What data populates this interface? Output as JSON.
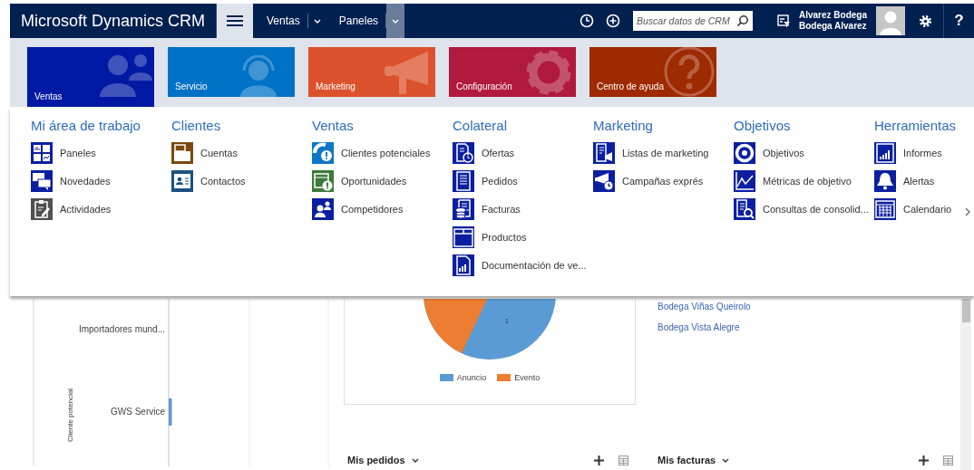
{
  "header": {
    "app_title": "Microsoft Dynamics CRM",
    "nav": [
      {
        "label": "Ventas",
        "active": false
      },
      {
        "label": "Paneles",
        "active": true
      }
    ],
    "search": {
      "placeholder": "Buscar datos de CRM"
    },
    "user": {
      "name": "Alvarez Bodega",
      "organization": "Bodega Alvarez"
    },
    "help": "?"
  },
  "tiles": [
    {
      "label": "Ventas",
      "kind": "people",
      "color": "#0019a5",
      "selected": true
    },
    {
      "label": "Servicio",
      "kind": "agent",
      "color": "#0072c6",
      "selected": false
    },
    {
      "label": "Marketing",
      "kind": "megaphone",
      "color": "#dc522c",
      "selected": false
    },
    {
      "label": "Configuración",
      "kind": "gear",
      "color": "#b1193e",
      "selected": false
    },
    {
      "label": "Centro de ayuda",
      "kind": "help",
      "color": "#9e2a00",
      "selected": false
    }
  ],
  "menu": {
    "groups": [
      {
        "title": "Mi área de trabajo",
        "items": [
          {
            "label": "Paneles",
            "kind": "dashboard",
            "color": "#0b1fa0"
          },
          {
            "label": "Novedades",
            "kind": "feed",
            "color": "#0b1fa0"
          },
          {
            "label": "Actividades",
            "kind": "activity",
            "color": "#505050"
          }
        ]
      },
      {
        "title": "Clientes",
        "items": [
          {
            "label": "Cuentas",
            "kind": "account",
            "color": "#7a4a10"
          },
          {
            "label": "Contactos",
            "kind": "contact",
            "color": "#1a5282"
          }
        ]
      },
      {
        "title": "Ventas",
        "items": [
          {
            "label": "Clientes potenciales",
            "kind": "lead",
            "color": "#0f76c8"
          },
          {
            "label": "Oportunidades",
            "kind": "opportunity",
            "color": "#3e7a3a"
          },
          {
            "label": "Competidores",
            "kind": "competitor",
            "color": "#0b1fa0"
          }
        ]
      },
      {
        "title": "Colateral",
        "items": [
          {
            "label": "Ofertas",
            "kind": "quote",
            "color": "#0b1fa0"
          },
          {
            "label": "Pedidos",
            "kind": "order",
            "color": "#0b1fa0"
          },
          {
            "label": "Facturas",
            "kind": "invoice",
            "color": "#0b1fa0"
          },
          {
            "label": "Productos",
            "kind": "product",
            "color": "#0b1fa0"
          },
          {
            "label": "Documentación de ve...",
            "kind": "doc",
            "color": "#0b1fa0"
          }
        ]
      },
      {
        "title": "Marketing",
        "items": [
          {
            "label": "Listas de marketing",
            "kind": "marketing-list",
            "color": "#0b1fa0"
          },
          {
            "label": "Campañas exprés",
            "kind": "campaign",
            "color": "#0b1fa0"
          }
        ]
      },
      {
        "title": "Objetivos",
        "items": [
          {
            "label": "Objetivos",
            "kind": "goal",
            "color": "#0b1fa0"
          },
          {
            "label": "Métricas de objetivo",
            "kind": "metric",
            "color": "#0b1fa0"
          },
          {
            "label": "Consultas de consolid...",
            "kind": "rollup",
            "color": "#0b1fa0"
          }
        ]
      },
      {
        "title": "Herramientas",
        "items": [
          {
            "label": "Informes",
            "kind": "report",
            "color": "#0b1fa0"
          },
          {
            "label": "Alertas",
            "kind": "alert",
            "color": "#0b1fa0"
          },
          {
            "label": "Calendario",
            "kind": "calendar",
            "color": "#0b1fa0"
          }
        ]
      }
    ]
  },
  "dashboard": {
    "bar_chart": {
      "axis_title": "Cliente potencial",
      "categories": [
        "Importadores mund...",
        "GWS Service"
      ]
    },
    "pie_chart": {
      "data_label": "1",
      "legend": [
        {
          "label": "Anuncio",
          "color": "#5b9bd5"
        },
        {
          "label": "Evento",
          "color": "#ed7d31"
        }
      ]
    },
    "account_links": [
      "Bodega Viñas Queirolo",
      "Bodega Vista Alegre"
    ],
    "lists": [
      {
        "title": "Mis pedidos"
      },
      {
        "title": "Mis facturas"
      }
    ]
  }
}
